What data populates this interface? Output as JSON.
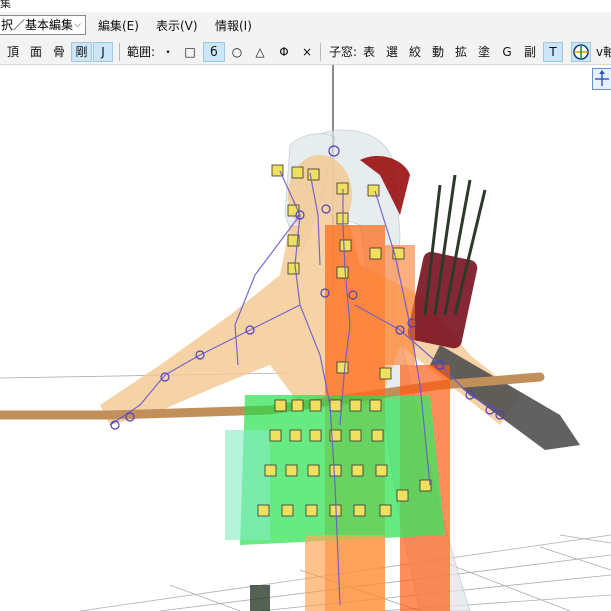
{
  "window": {
    "title_fragment": "集"
  },
  "menubar": {
    "mode_select": "択／基本編集",
    "items": [
      "編集(E)",
      "表示(V)",
      "情報(I)"
    ]
  },
  "toolbar": {
    "group1": [
      "頂",
      "面",
      "骨",
      "剛",
      "J"
    ],
    "range_label": "範囲:",
    "range_buttons": [
      "・",
      "□",
      "б",
      "○",
      "△",
      "Φ",
      "×"
    ],
    "child_window_label": "子窓:",
    "child_buttons": [
      "表",
      "選",
      "絞",
      "動",
      "拡",
      "塗",
      "G",
      "副",
      "T"
    ],
    "tail": "v軸"
  },
  "icons": {
    "dropdown": "chevron-down-icon",
    "globe": "globe-icon",
    "axis": "axis-gizmo-icon"
  },
  "colors": {
    "menubar_bg": "#f3f3f3",
    "toggle_active": "#cde6f7",
    "bone_line": "#6a5acd",
    "joint_fill": "#f0e060",
    "rigid_body_orange": "#ff6a1a",
    "rigid_body_green": "#22e04a"
  }
}
